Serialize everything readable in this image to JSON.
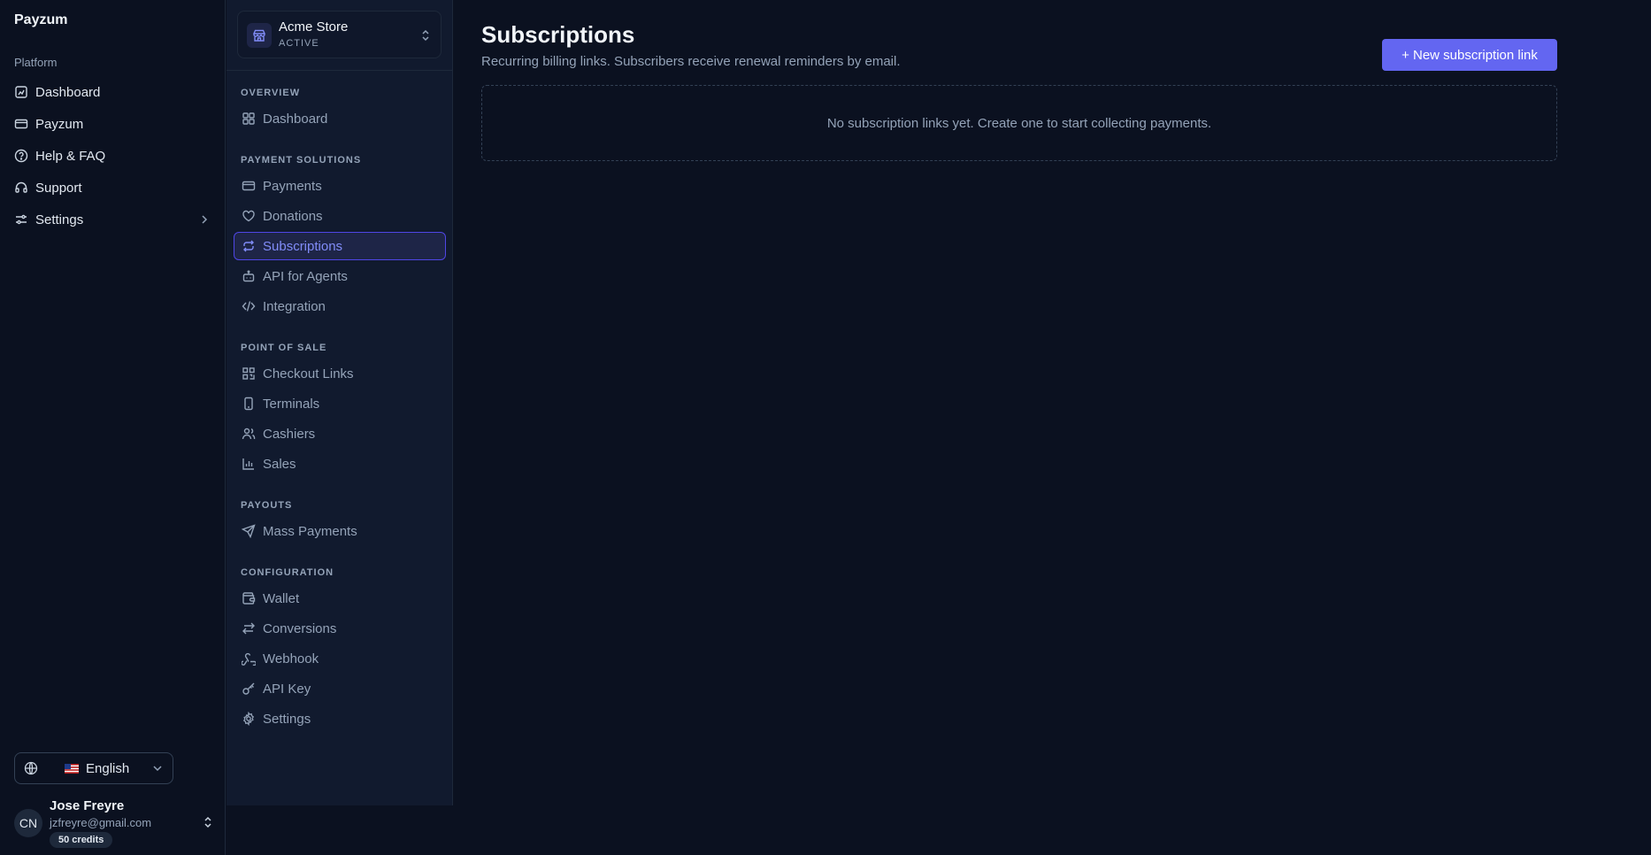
{
  "app": {
    "brand": "Payzum"
  },
  "platform_nav": {
    "section_label": "Platform",
    "items": [
      {
        "label": "Dashboard",
        "icon": "dashboard-icon"
      },
      {
        "label": "Payzum",
        "icon": "card-icon"
      },
      {
        "label": "Help & FAQ",
        "icon": "help-circle-icon"
      },
      {
        "label": "Support",
        "icon": "headset-icon"
      },
      {
        "label": "Settings",
        "icon": "sliders-icon"
      }
    ]
  },
  "language": {
    "label": "English",
    "flag": "US"
  },
  "user": {
    "initials": "CN",
    "name": "Jose Freyre",
    "email": "jzfreyre@gmail.com",
    "credits": "50 credits"
  },
  "store": {
    "name": "Acme Store",
    "status": "ACTIVE"
  },
  "store_nav": {
    "groups": [
      {
        "label": "OVERVIEW",
        "items": [
          {
            "label": "Dashboard"
          }
        ]
      },
      {
        "label": "PAYMENT SOLUTIONS",
        "items": [
          {
            "label": "Payments"
          },
          {
            "label": "Donations"
          },
          {
            "label": "Subscriptions",
            "active": true
          },
          {
            "label": "API for Agents"
          },
          {
            "label": "Integration"
          }
        ]
      },
      {
        "label": "POINT OF SALE",
        "items": [
          {
            "label": "Checkout Links"
          },
          {
            "label": "Terminals"
          },
          {
            "label": "Cashiers"
          },
          {
            "label": "Sales"
          }
        ]
      },
      {
        "label": "PAYOUTS",
        "items": [
          {
            "label": "Mass Payments"
          }
        ]
      },
      {
        "label": "CONFIGURATION",
        "items": [
          {
            "label": "Wallet"
          },
          {
            "label": "Conversions"
          },
          {
            "label": "Webhook"
          },
          {
            "label": "API Key"
          },
          {
            "label": "Settings"
          }
        ]
      }
    ]
  },
  "main": {
    "title": "Subscriptions",
    "subtitle": "Recurring billing links. Subscribers receive renewal reminders by email.",
    "new_button": "+ New subscription link",
    "empty_message": "No subscription links yet. Create one to start collecting payments."
  },
  "colors": {
    "background": "#0b1120",
    "sidebar": "#111a2e",
    "accent": "#6366f1",
    "active_text": "#818cf8"
  }
}
